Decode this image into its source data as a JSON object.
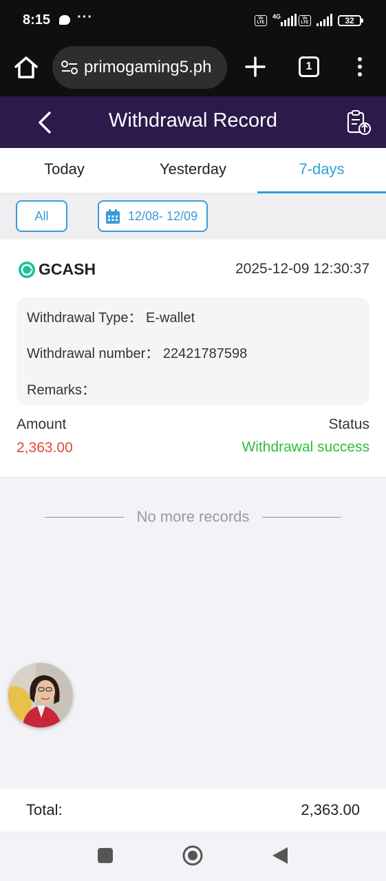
{
  "status_bar": {
    "time": "8:15",
    "dots": "···",
    "net_label": "4G",
    "volte_label": "Vo LTE",
    "battery": "32"
  },
  "browser": {
    "url": "primogaming5.ph",
    "tab_count": "1"
  },
  "header": {
    "title": "Withdrawal Record"
  },
  "tabs": [
    {
      "label": "Today",
      "active": false
    },
    {
      "label": "Yesterday",
      "active": false
    },
    {
      "label": "7-days",
      "active": true
    }
  ],
  "filters": {
    "all_label": "All",
    "date_range": "12/08- 12/09"
  },
  "record": {
    "method": "GCASH",
    "timestamp": "2025-12-09 12:30:37",
    "type_label": "Withdrawal Type：",
    "type_value": "E-wallet",
    "number_label": "Withdrawal number：",
    "number_value": "22421787598",
    "remarks_label": "Remarks：",
    "amount_label": "Amount",
    "amount_value": "2,363.00",
    "status_label": "Status",
    "status_value": "Withdrawal success"
  },
  "list_end": {
    "text": "No more records"
  },
  "total": {
    "label": "Total:",
    "value": "2,363.00"
  },
  "colors": {
    "header_bg": "#2b1a4a",
    "accent": "#2e9fd8",
    "amount": "#e04a3a",
    "success": "#2fbd3a",
    "gcash": "#1fbf9c"
  }
}
